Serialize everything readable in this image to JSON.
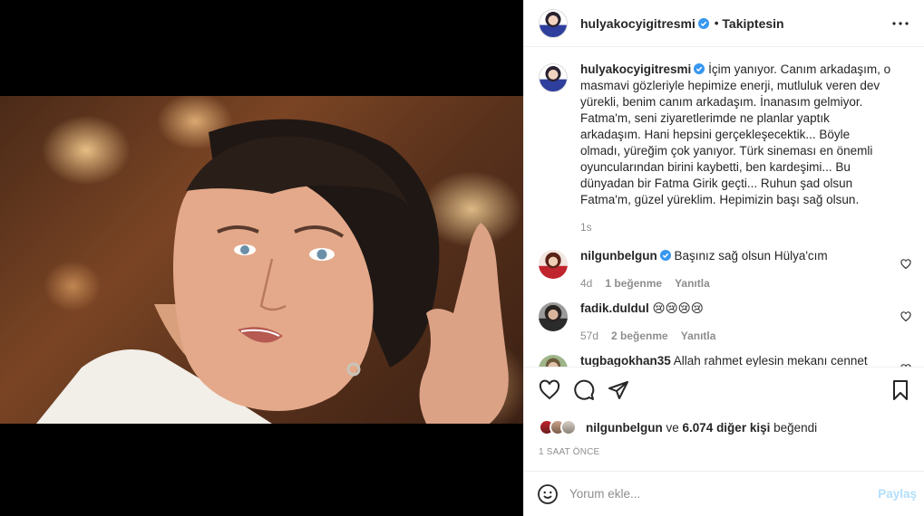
{
  "post": {
    "username": "hulyakocyigitresmi",
    "follow_status": "Takiptesin",
    "separator": "•"
  },
  "caption": {
    "username": "hulyakocyigitresmi",
    "text": "İçim yanıyor. Canım arkadaşım, o masmavi gözleriyle hepimize enerji, mutluluk veren dev yürekli, benim canım arkadaşım.  İnanasım gelmiyor. Fatma'm, seni ziyaretlerimde ne planlar yaptık arkadaşım. Hani hepsini gerçekleşecektik... Böyle olmadı, yüreğim çok yanıyor. Türk sineması en önemli oyuncularından birini kaybetti, ben kardeşimi... Bu dünyadan bir Fatma Girik geçti... Ruhun şad olsun Fatma'm, güzel yüreklim. Hepimizin başı sağ olsun.",
    "age": "1s"
  },
  "comments": [
    {
      "username": "nilgunbelgun",
      "text": "Başınız sağ olsun Hülya'cım",
      "age": "4d",
      "likes": "1 beğenme",
      "reply": "Yanıtla"
    },
    {
      "username": "fadik.duldul",
      "text": "😢😢😢😢",
      "age": "57d",
      "likes": "2 beğenme",
      "reply": "Yanıtla"
    },
    {
      "username": "tugbagokhan35",
      "text": "Allah rahmet eylesin mekanı cennet olsun 😢😢"
    }
  ],
  "likes": {
    "first_user": "nilgunbelgun",
    "connector": "ve",
    "others": "6.074 diğer kişi",
    "suffix": "beğendi"
  },
  "timestamp": "1 SAAT ÖNCE",
  "add_comment": {
    "placeholder": "Yorum ekle...",
    "post_label": "Paylaş"
  },
  "colors": {
    "verified": "#3897f0",
    "post_disabled": "#b2dffc",
    "meta": "#8e8e8e"
  }
}
